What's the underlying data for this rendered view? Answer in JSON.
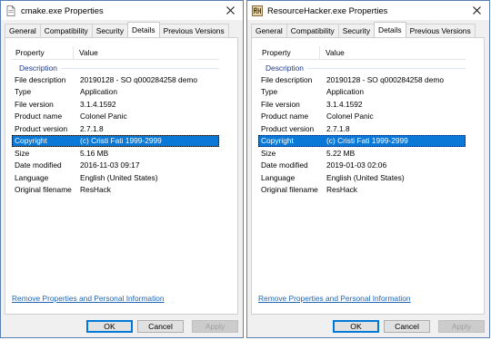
{
  "icons": {
    "window_left": "document-icon",
    "window_right": "resource-hacker-icon",
    "close": "close-icon"
  },
  "windows": [
    {
      "title": "cmake.exe Properties",
      "tabs": [
        "General",
        "Compatibility",
        "Security",
        "Details",
        "Previous Versions"
      ],
      "active_tab": 3,
      "header": {
        "property": "Property",
        "value": "Value"
      },
      "group": "Description",
      "rows": [
        {
          "property": "File description",
          "value": "20190128 - SO q000284258 demo"
        },
        {
          "property": "Type",
          "value": "Application"
        },
        {
          "property": "File version",
          "value": "3.1.4.1592"
        },
        {
          "property": "Product name",
          "value": "Colonel Panic"
        },
        {
          "property": "Product version",
          "value": "2.7.1.8"
        },
        {
          "property": "Copyright",
          "value": "(c) Cristi Fati 1999-2999"
        },
        {
          "property": "Size",
          "value": "5.16 MB"
        },
        {
          "property": "Date modified",
          "value": "2016-11-03 09:17"
        },
        {
          "property": "Language",
          "value": "English (United States)"
        },
        {
          "property": "Original filename",
          "value": "ResHack"
        }
      ],
      "selected_row": 5,
      "link": "Remove Properties and Personal Information",
      "buttons": {
        "ok": "OK",
        "cancel": "Cancel",
        "apply": "Apply"
      }
    },
    {
      "title": "ResourceHacker.exe Properties",
      "tabs": [
        "General",
        "Compatibility",
        "Security",
        "Details",
        "Previous Versions"
      ],
      "active_tab": 3,
      "header": {
        "property": "Property",
        "value": "Value"
      },
      "group": "Description",
      "rows": [
        {
          "property": "File description",
          "value": "20190128 - SO q000284258 demo"
        },
        {
          "property": "Type",
          "value": "Application"
        },
        {
          "property": "File version",
          "value": "3.1.4.1592"
        },
        {
          "property": "Product name",
          "value": "Colonel Panic"
        },
        {
          "property": "Product version",
          "value": "2.7.1.8"
        },
        {
          "property": "Copyright",
          "value": "(c) Cristi Fati 1999-2999"
        },
        {
          "property": "Size",
          "value": "5.22 MB"
        },
        {
          "property": "Date modified",
          "value": "2019-01-03 02:06"
        },
        {
          "property": "Language",
          "value": "English (United States)"
        },
        {
          "property": "Original filename",
          "value": "ResHack"
        }
      ],
      "selected_row": 5,
      "link": "Remove Properties and Personal Information",
      "buttons": {
        "ok": "OK",
        "cancel": "Cancel",
        "apply": "Apply"
      }
    }
  ]
}
